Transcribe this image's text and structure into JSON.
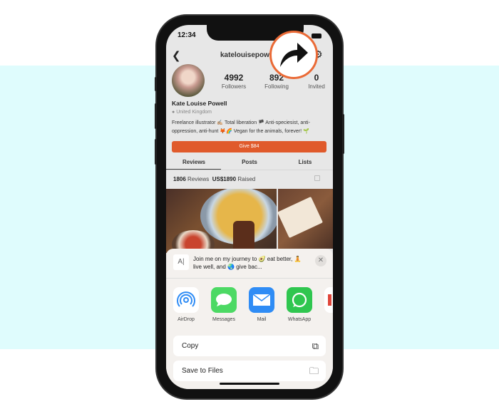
{
  "status": {
    "time": "12:34"
  },
  "header": {
    "username": "katelouisepowell"
  },
  "profile": {
    "stats": [
      {
        "value": "4992",
        "label": "Followers"
      },
      {
        "value": "892",
        "label": "Following"
      },
      {
        "value": "0",
        "label": "Invited"
      }
    ],
    "name": "Kate Louise Powell",
    "location": "United Kingdom",
    "bio": "Freelance illustrator ✍🏼 Total liberation 🏴 Anti-speciesist, anti-oppression, anti-hunt 🦊🌈 Vegan for the animals, forever! 🌱",
    "give_label": "Give $84"
  },
  "tabs": [
    {
      "label": "Reviews",
      "active": true
    },
    {
      "label": "Posts"
    },
    {
      "label": "Lists"
    }
  ],
  "counts": {
    "reviews_num": "1806",
    "reviews_label": "Reviews",
    "raised_num": "US$1890",
    "raised_label": "Raised"
  },
  "share_sheet": {
    "thumb": "A|",
    "message": "Join me on my journey to 🥑 eat better, 🧘 live well, and 🌏 give bac...",
    "apps": [
      {
        "label": "AirDrop",
        "color": "#ffffff"
      },
      {
        "label": "Messages",
        "color": "#4cd964"
      },
      {
        "label": "Mail",
        "color": "#2f8cf5"
      },
      {
        "label": "WhatsApp",
        "color": "#2fc64f"
      }
    ],
    "actions": [
      {
        "label": "Copy",
        "icon": "copy-icon"
      },
      {
        "label": "Save to Files",
        "icon": "folder-icon"
      }
    ]
  },
  "accent": "#e05a2b",
  "highlight": {
    "icon": "share-arrow-icon",
    "border": "#ea6a36"
  }
}
